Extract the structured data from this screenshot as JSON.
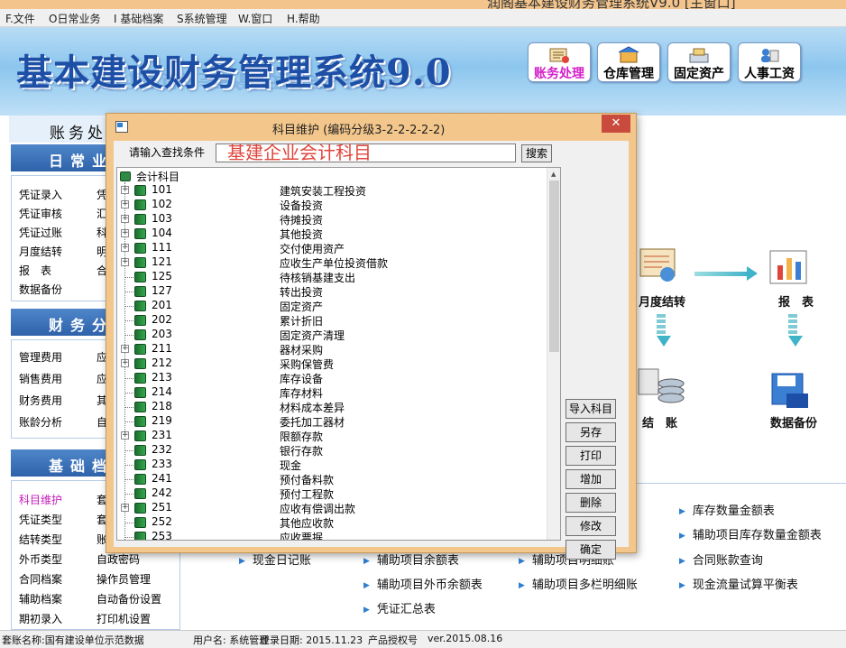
{
  "window": {
    "title_fragment": "润阁基本建设财务管理系统V9.0  [主窗口]"
  },
  "menubar": [
    {
      "label": "F.文件"
    },
    {
      "label": "O日常业务"
    },
    {
      "label": "I 基础档案"
    },
    {
      "label": "S系统管理"
    },
    {
      "label": "W.窗口"
    },
    {
      "label": "H.帮助"
    }
  ],
  "banner": {
    "title": "基本建设财务管理系统9.0",
    "modules": [
      {
        "label": "账务处理",
        "icon": "ledger-icon",
        "active": true
      },
      {
        "label": "仓库管理",
        "icon": "warehouse-icon",
        "active": false
      },
      {
        "label": "固定资产",
        "icon": "assets-icon",
        "active": false
      },
      {
        "label": "人事工资",
        "icon": "hr-icon",
        "active": false
      }
    ]
  },
  "leftnav": {
    "header": "账务处",
    "sections": [
      {
        "title": "日常业务",
        "items": [
          [
            "凭证录入",
            "凭"
          ],
          [
            "凭证审核",
            "汇"
          ],
          [
            "凭证过账",
            "科"
          ],
          [
            "月度结转",
            "明"
          ],
          [
            "报　表",
            "合"
          ],
          [
            "数据备份",
            ""
          ]
        ]
      },
      {
        "title": "财务分析",
        "items": [
          [
            "管理费用",
            "应"
          ],
          [
            "销售费用",
            "应"
          ],
          [
            "财务费用",
            "其"
          ],
          [
            "账龄分析",
            "自"
          ]
        ]
      },
      {
        "title": "基础档案",
        "items": [
          [
            "科目维护",
            "套"
          ],
          [
            "凭证类型",
            "套"
          ],
          [
            "结转类型",
            "账"
          ],
          [
            "外币类型",
            "自政密码"
          ],
          [
            "合同档案",
            "操作员管理"
          ],
          [
            "辅助档案",
            "自动备份设置"
          ],
          [
            "期初录入",
            "打印机设置"
          ]
        ]
      }
    ]
  },
  "flow": {
    "month_close": "月度结转",
    "report": "报　表",
    "close": "结　账",
    "backup": "数据备份"
  },
  "reports": {
    "col1": [
      "现金日记账"
    ],
    "col2": [
      "辅助项目余额表",
      "辅助项目外币余额表",
      "凭证汇总表"
    ],
    "col3": [
      "辅助项目明细账",
      "辅助项目多栏明细账"
    ],
    "col4": [
      "库存数量金额表",
      "辅助项目库存数量金额表",
      "合同账款查询",
      "现金流量试算平衡表"
    ]
  },
  "statusbar": {
    "ledger": "套账名称:国有建设单位示范数据",
    "user": "用户名: 系统管理",
    "login": "登录日期: 2015.11.23",
    "license": "产品授权号",
    "version": "ver.2015.08.16"
  },
  "dialog": {
    "title": "科目维护 (编码分级3-2-2-2-2-2)",
    "close_label": "✕",
    "search_label": "请输入查找条件",
    "search_value": "基建企业会计科目",
    "search_button": "搜索",
    "tree_root": "会计科目",
    "accounts": [
      {
        "code": "101",
        "name": "建筑安装工程投资",
        "expandable": true
      },
      {
        "code": "102",
        "name": "设备投资",
        "expandable": true
      },
      {
        "code": "103",
        "name": "待摊投资",
        "expandable": true
      },
      {
        "code": "104",
        "name": "其他投资",
        "expandable": true
      },
      {
        "code": "111",
        "name": "交付使用资产",
        "expandable": true
      },
      {
        "code": "121",
        "name": "应收生产单位投资借款",
        "expandable": true
      },
      {
        "code": "125",
        "name": "待核销基建支出",
        "expandable": false
      },
      {
        "code": "127",
        "name": "转出投资",
        "expandable": false
      },
      {
        "code": "201",
        "name": "固定资产",
        "expandable": false
      },
      {
        "code": "202",
        "name": "累计折旧",
        "expandable": false
      },
      {
        "code": "203",
        "name": "固定资产清理",
        "expandable": false
      },
      {
        "code": "211",
        "name": "器材采购",
        "expandable": true
      },
      {
        "code": "212",
        "name": "采购保管费",
        "expandable": true
      },
      {
        "code": "213",
        "name": "库存设备",
        "expandable": false
      },
      {
        "code": "214",
        "name": "库存材料",
        "expandable": false
      },
      {
        "code": "218",
        "name": "材料成本差异",
        "expandable": false
      },
      {
        "code": "219",
        "name": "委托加工器材",
        "expandable": false
      },
      {
        "code": "231",
        "name": "限额存款",
        "expandable": true
      },
      {
        "code": "232",
        "name": "银行存款",
        "expandable": false
      },
      {
        "code": "233",
        "name": "现金",
        "expandable": false
      },
      {
        "code": "241",
        "name": "预付备料款",
        "expandable": false
      },
      {
        "code": "242",
        "name": "预付工程款",
        "expandable": false
      },
      {
        "code": "251",
        "name": "应收有偿调出款",
        "expandable": true
      },
      {
        "code": "252",
        "name": "其他应收款",
        "expandable": false
      },
      {
        "code": "253",
        "name": "应收票据",
        "expandable": false
      }
    ],
    "buttons": [
      "导入科目",
      "另存",
      "打印",
      "增加",
      "删除",
      "修改",
      "确定"
    ]
  }
}
